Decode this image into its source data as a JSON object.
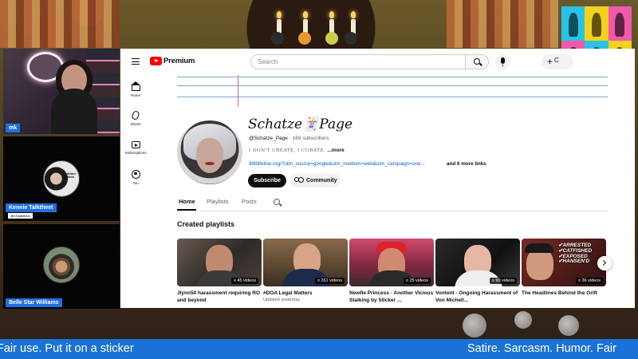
{
  "youtube": {
    "brand": "Premium",
    "search_placeholder": "Search",
    "create_label": "C",
    "nav": [
      {
        "label": "Home"
      },
      {
        "label": "Shorts"
      },
      {
        "label": "Subscriptions"
      },
      {
        "label": "You"
      }
    ],
    "channel": {
      "name": "Schatze🃏Page",
      "handle": "@Schatze_Page",
      "subscribers": " · 169 subscribers",
      "description": "I DON'T CREATE, I CURATE. ",
      "description_more": "...more",
      "link": "988lifeline.org/?utm_source=google&utm_medium=web&utm_campaign=one...",
      "more_links": "and 6 more links",
      "subscribe_label": "Subscribe",
      "community_label": "Community"
    },
    "tabs": [
      {
        "label": "Home",
        "active": true
      },
      {
        "label": "Playlists",
        "active": false
      },
      {
        "label": "Posts",
        "active": false
      }
    ],
    "section_title": "Created playlists",
    "playlists": [
      {
        "title": "Jlynn50 harassment requiring RO and beyond",
        "count": "45 videos",
        "meta": "",
        "caption": ""
      },
      {
        "title": "#DOA Legal Matters",
        "count": "261 videos",
        "meta": "Updated yesterday",
        "caption": ""
      },
      {
        "title": "Newfie Princess - Another Vicious Stalking by Sticker ...",
        "count": "25 videos",
        "meta": "",
        "caption": ""
      },
      {
        "title": "Vontent - Ongoing Harassment of Von Michell...",
        "count": "90 videos",
        "meta": "",
        "caption": ""
      },
      {
        "title": "The Headlines Behind the Grift",
        "count": "36 videos",
        "meta": "",
        "caption": "✔ARRESTED\n✔CATFISHED\n✔EXPOSED\n✔HANSEN'D"
      }
    ]
  },
  "stream": {
    "cams": [
      {
        "label": "mk",
        "sub": ""
      },
      {
        "label": "Kennie Talktheet",
        "sub": "@KDtalktheat",
        "avatar_text": "Sedition Matters"
      },
      {
        "label": "Belle Star Williams",
        "sub": ""
      }
    ],
    "ticker_left": "Fair use. Put it on a sticker",
    "ticker_right": "Satire. Sarcasm. Humor. Fair"
  },
  "colors": {
    "yt_red": "#ff0000",
    "link_blue": "#065fd4",
    "stream_blue": "#1a72d6",
    "pop_cyan": "#27c4e8",
    "pop_pink": "#f05aa8",
    "pop_yellow": "#f2d21c"
  }
}
